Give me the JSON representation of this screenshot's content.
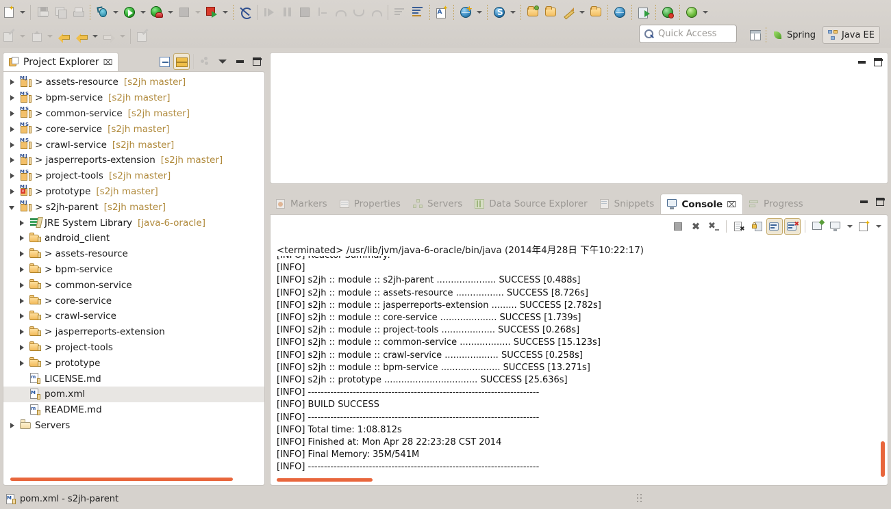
{
  "toolbar": {
    "row1": [
      {
        "name": "new-wizard-button",
        "icon": "new-file-icon",
        "enabled": true
      },
      {
        "name": "new-wizard-dropdown",
        "icon": "chevron-down-icon",
        "enabled": true
      },
      {
        "name": "save-button",
        "icon": "save-icon",
        "enabled": false
      },
      {
        "name": "save-all-button",
        "icon": "save-all-icon",
        "enabled": false
      },
      {
        "name": "print-button",
        "icon": "print-icon",
        "enabled": false
      },
      {
        "name": "debug-button",
        "icon": "bug-icon",
        "enabled": true
      },
      {
        "name": "debug-dropdown",
        "icon": "chevron-down-icon",
        "enabled": true
      },
      {
        "name": "run-button",
        "icon": "run-green-play-icon",
        "enabled": true
      },
      {
        "name": "run-dropdown",
        "icon": "chevron-down-icon",
        "enabled": true
      },
      {
        "name": "run-on-server-button",
        "icon": "run-server-icon",
        "enabled": true
      },
      {
        "name": "run-on-server-dropdown",
        "icon": "chevron-down-icon",
        "enabled": true
      },
      {
        "name": "terminate-button",
        "icon": "stop-square-icon",
        "enabled": false
      },
      {
        "name": "terminate-dropdown",
        "icon": "chevron-down-icon",
        "enabled": false
      },
      {
        "name": "stop-server-button",
        "icon": "stop-red-icon",
        "enabled": true
      },
      {
        "name": "stop-server-dropdown",
        "icon": "chevron-down-icon",
        "enabled": true
      },
      {
        "name": "skip-breakpoints-button",
        "icon": "breakpoint-skip-icon",
        "enabled": true
      },
      {
        "name": "resume-button",
        "icon": "resume-icon",
        "enabled": false
      },
      {
        "name": "suspend-button",
        "icon": "pause-icon",
        "enabled": false
      },
      {
        "name": "terminate-debug-button",
        "icon": "stop-square-icon",
        "enabled": false
      },
      {
        "name": "step-into-button",
        "icon": "step-into-icon",
        "enabled": false
      },
      {
        "name": "step-over-button",
        "icon": "step-over-icon",
        "enabled": false
      },
      {
        "name": "step-return-button",
        "icon": "step-return-icon",
        "enabled": false
      },
      {
        "name": "step-filter-button",
        "icon": "step-filter-icon",
        "enabled": false
      },
      {
        "name": "open-task-button",
        "icon": "task-lines-icon",
        "enabled": false
      },
      {
        "name": "new-task-button",
        "icon": "task-new-lines-icon",
        "enabled": true
      },
      {
        "name": "new-java-class-button",
        "icon": "new-java-class-icon",
        "enabled": true
      },
      {
        "name": "new-web-project-button",
        "icon": "new-web-globe-icon",
        "enabled": true
      },
      {
        "name": "new-web-project-dropdown",
        "icon": "chevron-down-icon",
        "enabled": true
      },
      {
        "name": "new-spring-element-button",
        "icon": "spring-bean-icon",
        "enabled": true
      },
      {
        "name": "new-spring-element-dropdown",
        "icon": "chevron-down-icon",
        "enabled": true
      },
      {
        "name": "open-type-button",
        "icon": "open-folder-green-icon",
        "enabled": true
      },
      {
        "name": "open-resource-button",
        "icon": "open-folder-icon",
        "enabled": true
      },
      {
        "name": "edit-config-button",
        "icon": "pencil-icon",
        "enabled": true
      },
      {
        "name": "edit-config-dropdown",
        "icon": "chevron-down-icon",
        "enabled": true
      },
      {
        "name": "open-perspective-folder-button",
        "icon": "open-folder-icon",
        "enabled": true
      },
      {
        "name": "open-browser-button",
        "icon": "globe-icon",
        "enabled": true
      },
      {
        "name": "deploy-button",
        "icon": "deploy-icon",
        "enabled": true
      },
      {
        "name": "refresh-server-button",
        "icon": "refresh-green-icon",
        "enabled": true
      },
      {
        "name": "validate-button",
        "icon": "green-globe-icon",
        "enabled": true
      },
      {
        "name": "validate-dropdown",
        "icon": "chevron-down-icon",
        "enabled": true
      }
    ],
    "row2": [
      {
        "name": "annotation-button",
        "icon": "annotation-icon",
        "enabled": false
      },
      {
        "name": "annotation-dropdown",
        "icon": "chevron-down-icon",
        "enabled": false
      },
      {
        "name": "upload-button",
        "icon": "upload-icon",
        "enabled": false
      },
      {
        "name": "upload-dropdown",
        "icon": "chevron-down-icon",
        "enabled": false
      },
      {
        "name": "back-annotated-button",
        "icon": "back-arrow-star-icon",
        "enabled": true
      },
      {
        "name": "back-button",
        "icon": "back-arrow-icon",
        "enabled": true
      },
      {
        "name": "back-dropdown",
        "icon": "chevron-down-icon",
        "enabled": true
      },
      {
        "name": "forward-button",
        "icon": "forward-arrow-icon",
        "enabled": false
      },
      {
        "name": "forward-dropdown",
        "icon": "chevron-down-icon",
        "enabled": false
      },
      {
        "name": "new-annotation-button",
        "icon": "new-annotation-icon",
        "enabled": false
      }
    ]
  },
  "quick_access": {
    "placeholder": "Quick Access",
    "icon": "search-icon"
  },
  "perspectives": {
    "open_perspective_icon": "open-perspective-icon",
    "items": [
      {
        "label": "Spring",
        "icon": "spring-leaf-icon",
        "active": false
      },
      {
        "label": "Java EE",
        "icon": "java-ee-icon",
        "active": true
      }
    ]
  },
  "project_explorer": {
    "title": "Project Explorer",
    "close_glyph": "⌧",
    "toolbar": [
      {
        "name": "collapse-all-button",
        "icon": "collapse-all-icon",
        "toggled": false
      },
      {
        "name": "link-with-editor-button",
        "icon": "link-editor-icon",
        "toggled": true
      },
      {
        "name": "focus-on-active-task-button",
        "icon": "focus-dots-icon",
        "toggled": false
      },
      {
        "name": "view-menu-button",
        "icon": "chevron-down-icon",
        "toggled": false
      },
      {
        "name": "minimize-button",
        "icon": "minimize-icon",
        "toggled": false
      },
      {
        "name": "maximize-button",
        "icon": "maximize-icon",
        "toggled": false
      }
    ],
    "tree": [
      {
        "label": "assets-resource",
        "branch": "[s2jh master]",
        "icon": "maven-java-project-icon",
        "indent": 0,
        "twisty": "closed",
        "prefix": "> ",
        "selected": false
      },
      {
        "label": "bpm-service",
        "branch": "[s2jh master]",
        "icon": "maven-spring-project-icon",
        "indent": 0,
        "twisty": "closed",
        "prefix": "> ",
        "selected": false
      },
      {
        "label": "common-service",
        "branch": "[s2jh master]",
        "icon": "maven-spring-project-icon",
        "indent": 0,
        "twisty": "closed",
        "prefix": "> ",
        "selected": false
      },
      {
        "label": "core-service",
        "branch": "[s2jh master]",
        "icon": "maven-spring-project-icon",
        "indent": 0,
        "twisty": "closed",
        "prefix": "> ",
        "selected": false
      },
      {
        "label": "crawl-service",
        "branch": "[s2jh master]",
        "icon": "maven-spring-project-icon",
        "indent": 0,
        "twisty": "closed",
        "prefix": "> ",
        "selected": false
      },
      {
        "label": "jasperreports-extension",
        "branch": "[s2jh master]",
        "icon": "maven-java-project-icon",
        "indent": 0,
        "twisty": "closed",
        "prefix": "> ",
        "selected": false
      },
      {
        "label": "project-tools",
        "branch": "[s2jh master]",
        "icon": "maven-spring-project-icon",
        "indent": 0,
        "twisty": "closed",
        "prefix": "> ",
        "selected": false
      },
      {
        "label": "prototype",
        "branch": "[s2jh master]",
        "icon": "maven-java-error-project-icon",
        "indent": 0,
        "twisty": "closed",
        "prefix": "> ",
        "selected": false
      },
      {
        "label": "s2jh-parent",
        "branch": "[s2jh master]",
        "icon": "maven-java-project-icon",
        "indent": 0,
        "twisty": "open",
        "prefix": "> ",
        "selected": false
      },
      {
        "label": "JRE System Library",
        "branch": "[java-6-oracle]",
        "icon": "jre-library-icon",
        "indent": 1,
        "twisty": "closed",
        "prefix": "",
        "selected": false
      },
      {
        "label": "android_client",
        "branch": "",
        "icon": "package-folder-icon",
        "indent": 1,
        "twisty": "closed",
        "prefix": "",
        "selected": false
      },
      {
        "label": "assets-resource",
        "branch": "",
        "icon": "package-folder-icon",
        "indent": 1,
        "twisty": "closed",
        "prefix": "> ",
        "selected": false
      },
      {
        "label": "bpm-service",
        "branch": "",
        "icon": "package-folder-icon",
        "indent": 1,
        "twisty": "closed",
        "prefix": "> ",
        "selected": false
      },
      {
        "label": "common-service",
        "branch": "",
        "icon": "package-folder-icon",
        "indent": 1,
        "twisty": "closed",
        "prefix": "> ",
        "selected": false
      },
      {
        "label": "core-service",
        "branch": "",
        "icon": "package-folder-icon",
        "indent": 1,
        "twisty": "closed",
        "prefix": "> ",
        "selected": false
      },
      {
        "label": "crawl-service",
        "branch": "",
        "icon": "package-folder-icon",
        "indent": 1,
        "twisty": "closed",
        "prefix": "> ",
        "selected": false
      },
      {
        "label": "jasperreports-extension",
        "branch": "",
        "icon": "package-folder-icon",
        "indent": 1,
        "twisty": "closed",
        "prefix": "> ",
        "selected": false
      },
      {
        "label": "project-tools",
        "branch": "",
        "icon": "package-folder-icon",
        "indent": 1,
        "twisty": "closed",
        "prefix": "> ",
        "selected": false
      },
      {
        "label": "prototype",
        "branch": "",
        "icon": "package-folder-icon",
        "indent": 1,
        "twisty": "closed",
        "prefix": "> ",
        "selected": false
      },
      {
        "label": "LICENSE.md",
        "branch": "",
        "icon": "markdown-file-icon",
        "indent": 1,
        "twisty": "none",
        "prefix": "",
        "selected": false
      },
      {
        "label": "pom.xml",
        "branch": "",
        "icon": "maven-xml-file-icon",
        "indent": 1,
        "twisty": "none",
        "prefix": "",
        "selected": true
      },
      {
        "label": "README.md",
        "branch": "",
        "icon": "markdown-file-icon",
        "indent": 1,
        "twisty": "none",
        "prefix": "",
        "selected": false
      },
      {
        "label": "Servers",
        "branch": "",
        "icon": "servers-folder-icon",
        "indent": 0,
        "twisty": "closed",
        "prefix": "",
        "selected": false
      }
    ]
  },
  "editor": {
    "window_controls": [
      {
        "name": "editor-minimize-button",
        "icon": "minimize-icon"
      },
      {
        "name": "editor-maximize-button",
        "icon": "maximize-icon"
      }
    ]
  },
  "console_panel": {
    "tabs": [
      {
        "label": "Markers",
        "icon": "markers-icon",
        "active": false
      },
      {
        "label": "Properties",
        "icon": "properties-icon",
        "active": false
      },
      {
        "label": "Servers",
        "icon": "servers-icon",
        "active": false
      },
      {
        "label": "Data Source Explorer",
        "icon": "data-source-icon",
        "active": false
      },
      {
        "label": "Snippets",
        "icon": "snippets-icon",
        "active": false
      },
      {
        "label": "Console",
        "icon": "console-icon",
        "active": true
      },
      {
        "label": "Progress",
        "icon": "progress-icon",
        "active": false
      }
    ],
    "active_tab_close_glyph": "⌧",
    "window_controls": [
      {
        "name": "console-minimize-button",
        "icon": "minimize-icon"
      },
      {
        "name": "console-maximize-button",
        "icon": "maximize-icon"
      }
    ],
    "toolbar": [
      {
        "name": "terminate-button",
        "icon": "stop-square-icon",
        "toggled": false
      },
      {
        "name": "remove-launch-button",
        "icon": "remove-x-icon",
        "toggled": false
      },
      {
        "name": "remove-all-launches-button",
        "icon": "remove-all-x-icon",
        "toggled": false
      },
      {
        "name": "clear-console-button",
        "icon": "clear-console-icon",
        "toggled": false
      },
      {
        "name": "scroll-lock-button",
        "icon": "lock-icon",
        "toggled": false
      },
      {
        "name": "show-console-on-output-button",
        "icon": "show-console-output-icon",
        "toggled": true
      },
      {
        "name": "show-console-on-error-button",
        "icon": "show-console-error-icon",
        "toggled": true
      },
      {
        "name": "pin-console-button",
        "icon": "pin-console-icon",
        "toggled": false
      },
      {
        "name": "display-selected-console-button",
        "icon": "display-console-icon",
        "toggled": false
      },
      {
        "name": "display-selected-console-dropdown",
        "icon": "chevron-down-icon",
        "toggled": false
      },
      {
        "name": "open-console-button",
        "icon": "new-console-icon",
        "toggled": false
      },
      {
        "name": "open-console-dropdown",
        "icon": "chevron-down-icon",
        "toggled": false
      }
    ],
    "process_header": "<terminated> /usr/lib/jvm/java-6-oracle/bin/java (2014年4月28日 下午10:22:17)",
    "output_lines": [
      "[INFO] Reactor Summary:",
      "[INFO] ",
      "[INFO] s2jh :: module :: s2jh-parent ..................... SUCCESS [0.488s]",
      "[INFO] s2jh :: module :: assets-resource ................. SUCCESS [8.726s]",
      "[INFO] s2jh :: module :: jasperreports-extension ......... SUCCESS [2.782s]",
      "[INFO] s2jh :: module :: core-service .................... SUCCESS [1.739s]",
      "[INFO] s2jh :: module :: project-tools ................... SUCCESS [0.268s]",
      "[INFO] s2jh :: module :: common-service .................. SUCCESS [15.123s]",
      "[INFO] s2jh :: module :: crawl-service ................... SUCCESS [0.258s]",
      "[INFO] s2jh :: module :: bpm-service ..................... SUCCESS [13.271s]",
      "[INFO] s2jh :: prototype ................................. SUCCESS [25.636s]",
      "[INFO] ------------------------------------------------------------------------",
      "[INFO] BUILD SUCCESS",
      "[INFO] ------------------------------------------------------------------------",
      "[INFO] Total time: 1:08.812s",
      "[INFO] Finished at: Mon Apr 28 22:23:28 CST 2014",
      "[INFO] Final Memory: 35M/541M",
      "[INFO] ------------------------------------------------------------------------"
    ]
  },
  "statusbar": {
    "icon": "maven-xml-file-icon",
    "text": "pom.xml - s2jh-parent"
  },
  "colors": {
    "accent_orange": "#e8663c",
    "chrome": "#d6d2cd",
    "panel_bg": "#ffffff",
    "branch_label": "#b08a3c",
    "selection": "#e8e6e3"
  }
}
